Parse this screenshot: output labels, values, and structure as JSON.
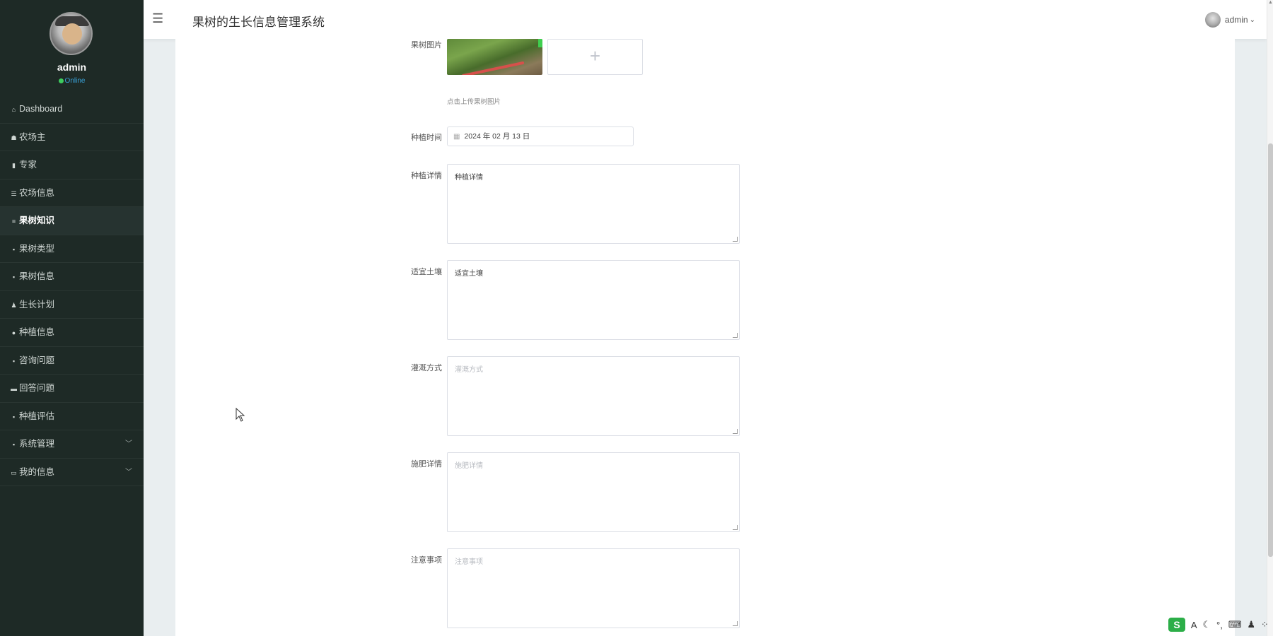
{
  "app": {
    "title": "果树的生长信息管理系统"
  },
  "user": {
    "name": "admin",
    "status": "Online"
  },
  "sidebar": {
    "items": [
      {
        "label": "Dashboard",
        "icon": "home-icon"
      },
      {
        "label": "农场主",
        "icon": "users-icon"
      },
      {
        "label": "专家",
        "icon": "chart-icon"
      },
      {
        "label": "农场信息",
        "icon": "briefcase-icon"
      },
      {
        "label": "果树知识",
        "icon": "list-icon",
        "active": true
      },
      {
        "label": "果树类型",
        "icon": "grid-icon"
      },
      {
        "label": "果树信息",
        "icon": "book-icon"
      },
      {
        "label": "生长计划",
        "icon": "user-icon"
      },
      {
        "label": "种植信息",
        "icon": "pin-icon"
      },
      {
        "label": "咨询问题",
        "icon": "doc-icon"
      },
      {
        "label": "回答问题",
        "icon": "message-icon"
      },
      {
        "label": "种植评估",
        "icon": "clipboard-icon"
      },
      {
        "label": "系统管理",
        "icon": "grid-icon",
        "expandable": true
      },
      {
        "label": "我的信息",
        "icon": "card-icon",
        "expandable": true
      }
    ]
  },
  "topbar": {
    "user_name": "admin"
  },
  "form": {
    "image_label": "果树图片",
    "upload_hint": "点击上传果树图片",
    "date_label": "种植时间",
    "date_value": "2024 年 02 月 13 日",
    "fields": [
      {
        "label": "种植详情",
        "value": "种植详情",
        "placeholder": "种植详情",
        "filled": true
      },
      {
        "label": "适宜土壤",
        "value": "适宜土壤",
        "placeholder": "适宜土壤",
        "filled": true
      },
      {
        "label": "灌溉方式",
        "value": "",
        "placeholder": "灌溉方式",
        "filled": false
      },
      {
        "label": "施肥详情",
        "value": "",
        "placeholder": "施肥详情",
        "filled": false
      },
      {
        "label": "注意事项",
        "value": "",
        "placeholder": "注意事项",
        "filled": false
      }
    ]
  },
  "ime": {
    "logo": "S",
    "mode": "A"
  },
  "colors": {
    "sidebar_bg": "#1e2a26",
    "content_bg": "#e9eef0",
    "status_dot": "#3dcc5f",
    "status_text": "#39a2d8"
  }
}
